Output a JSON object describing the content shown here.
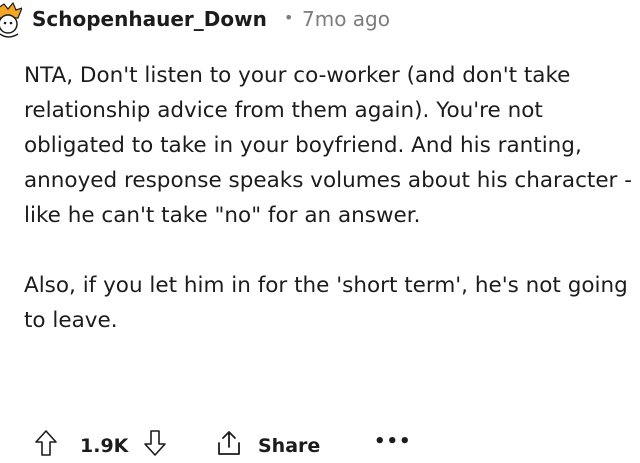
{
  "comment": {
    "username": "Schopenhauer_Down",
    "separator": "•",
    "age": "7mo ago",
    "paragraphs": [
      "NTA, Don't listen to your co-worker (and don't take relationship advice from them again). You're not obligated to take in your boyfriend. And his ranting, annoyed response speaks volumes about his character - like he can't take \"no\" for an answer.",
      "Also, if you let him in for the 'short term', he's not going to leave."
    ]
  },
  "actions": {
    "score": "1.9K",
    "share_label": "Share",
    "more_label": "•••"
  },
  "icons": {
    "avatar": "avatar",
    "upvote": "upvote-arrow-icon",
    "downvote": "downvote-arrow-icon",
    "share": "share-icon",
    "more": "more-options-icon"
  }
}
